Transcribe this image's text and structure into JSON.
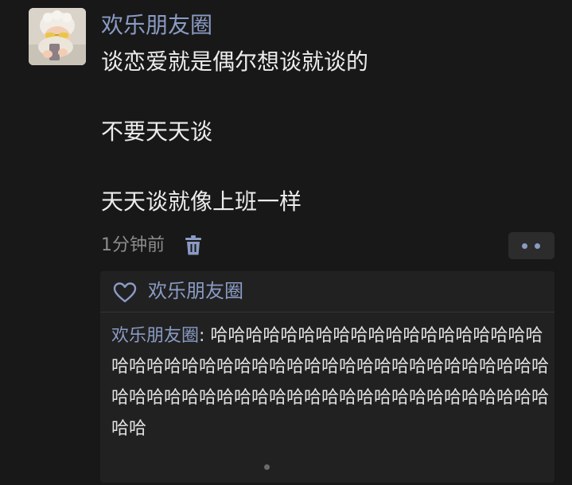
{
  "post": {
    "author": "欢乐朋友圈",
    "content_lines": [
      "谈恋爱就是偶尔想谈就谈的",
      "不要天天谈",
      "天天谈就像上班一样"
    ],
    "time": "1分钟前"
  },
  "interactions": {
    "likes": [
      "欢乐朋友圈"
    ],
    "comments": [
      {
        "author": "欢乐朋友圈",
        "separator": ": ",
        "text": "哈哈哈哈哈哈哈哈哈哈哈哈哈哈哈哈哈哈哈哈哈哈哈哈哈哈哈哈哈哈哈哈哈哈哈哈哈哈哈哈哈哈哈哈哈哈哈哈哈哈哈哈哈哈哈哈哈哈哈哈哈哈哈哈哈哈哈哈哈哈哈"
      }
    ]
  },
  "icons": {
    "delete": "trash-icon",
    "more": "more-dots-icon",
    "like": "heart-outline-icon"
  },
  "colors": {
    "background": "#181818",
    "panel": "#212121",
    "accent_name": "#8a9bc4",
    "text": "#ececec",
    "muted": "#8c8c8c"
  }
}
